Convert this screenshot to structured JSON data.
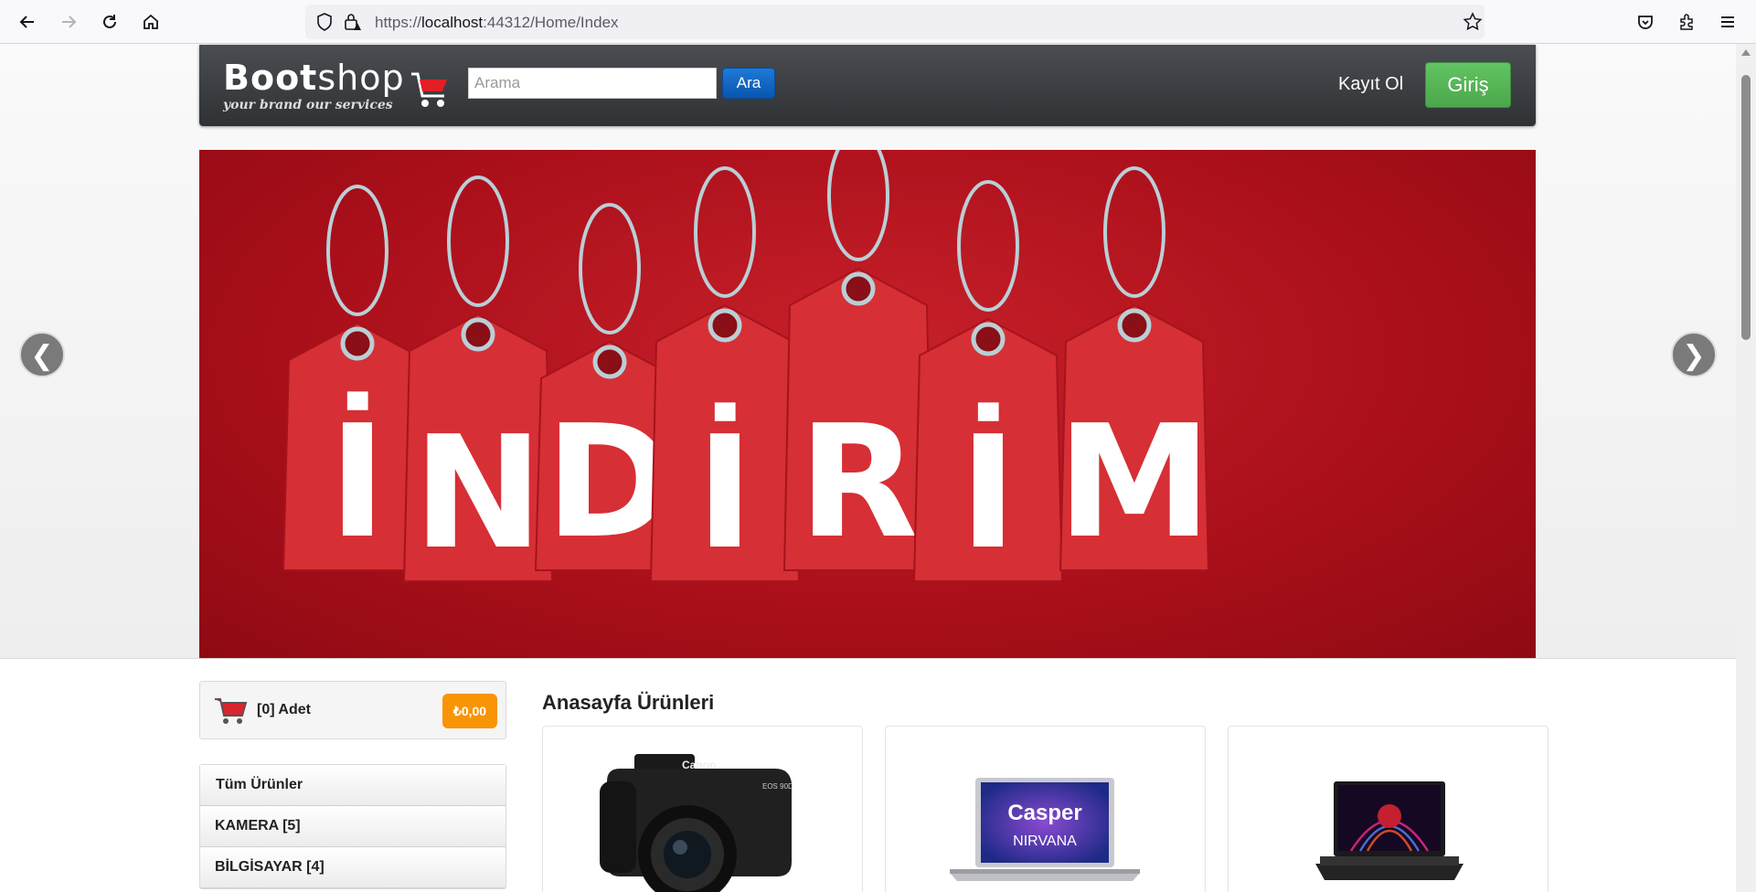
{
  "browser": {
    "url_prefix": "https://",
    "url_host": "localhost",
    "url_rest": ":44312/Home/Index"
  },
  "header": {
    "logo_bold": "Boot",
    "logo_light": "shop",
    "logo_tagline": "your brand our services",
    "search_placeholder": "Arama",
    "search_button": "Ara",
    "register_link": "Kayıt Ol",
    "login_button": "Giriş"
  },
  "slider": {
    "banner_letters": [
      "İ",
      "N",
      "D",
      "İ",
      "R",
      "İ",
      "M"
    ],
    "prev_arrow": "❮",
    "next_arrow": "❯"
  },
  "cart": {
    "count_label": "[0] Adet",
    "total": "₺0,00"
  },
  "categories": [
    {
      "label": "Tüm Ürünler"
    },
    {
      "label": "KAMERA [5]"
    },
    {
      "label": "BİLGİSAYAR [4]"
    }
  ],
  "main": {
    "section_title": "Anasayfa Ürünleri",
    "product_images": [
      {
        "brand": "Canon",
        "model": "EOS 90D"
      },
      {
        "brand": "Casper",
        "model": "NIRVANA"
      },
      {
        "brand": "",
        "model": ""
      }
    ]
  },
  "colors": {
    "banner_red": "#b3121d",
    "tag_red": "#d62f35",
    "login_green": "#5bb75b",
    "price_orange": "#f89406",
    "search_blue": "#0e66c8"
  }
}
